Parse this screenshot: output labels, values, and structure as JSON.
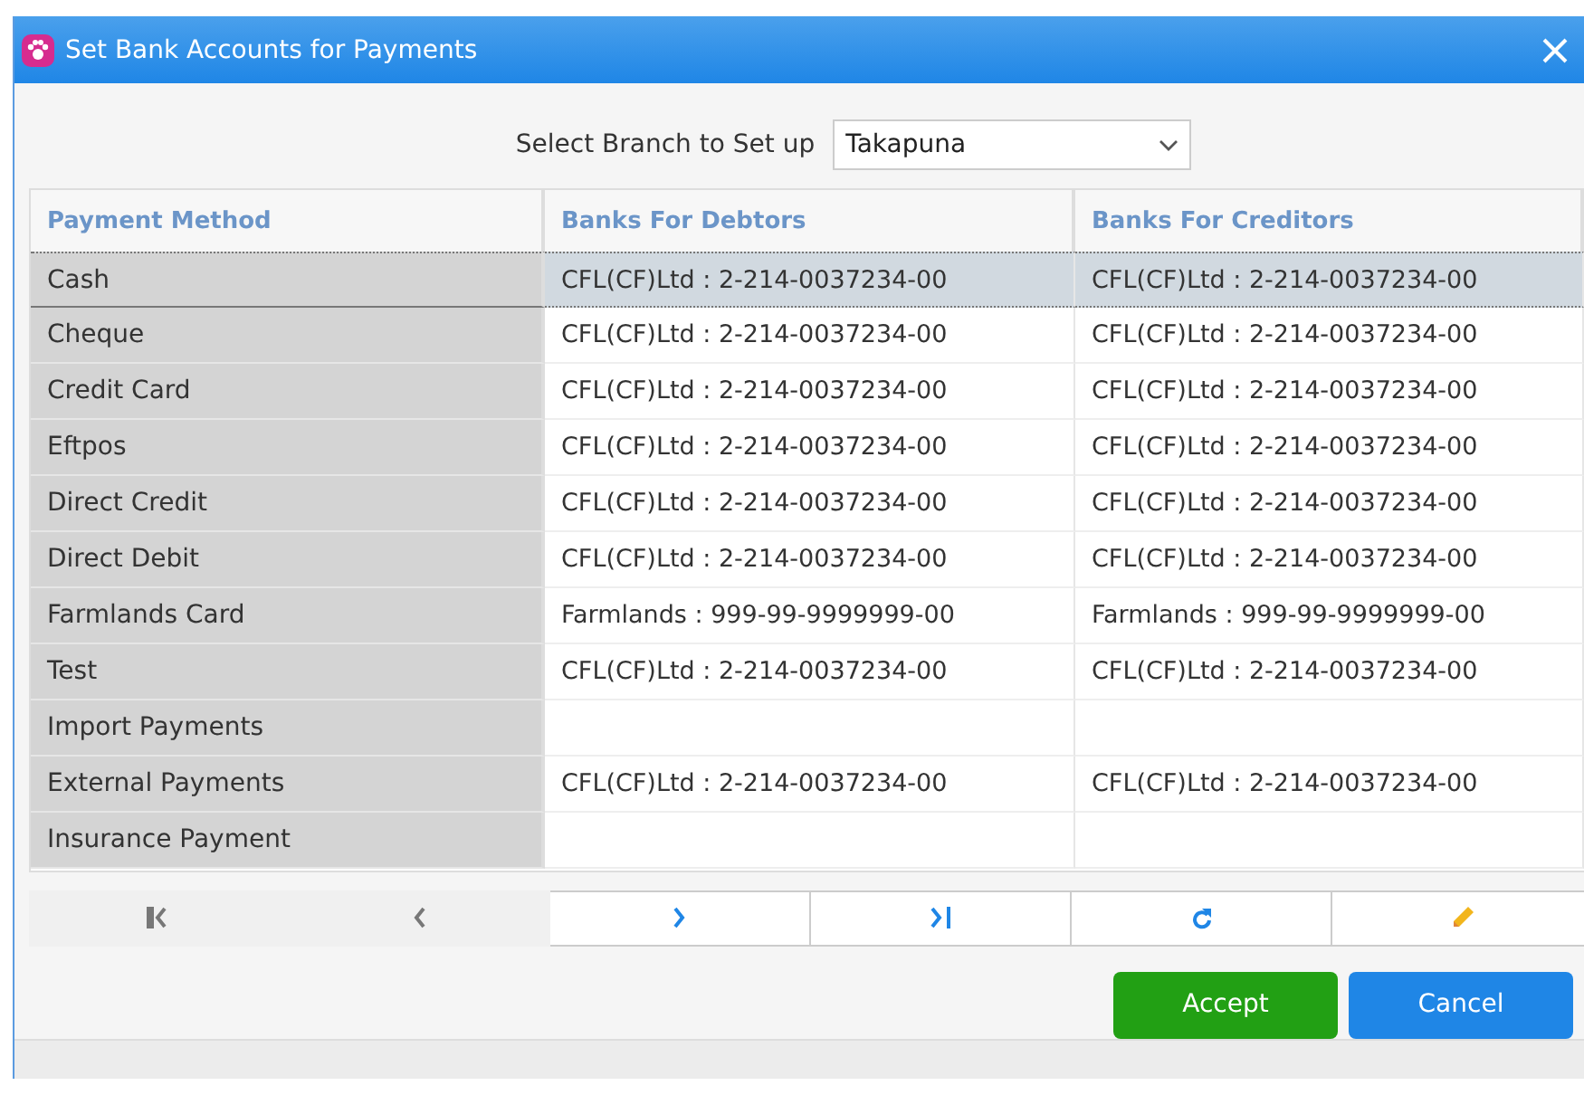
{
  "window": {
    "title": "Set Bank Accounts for Payments"
  },
  "branch": {
    "label": "Select Branch to Set up",
    "value": "Takapuna"
  },
  "table": {
    "columns": [
      "Payment Method",
      "Banks For Debtors",
      "Banks For Creditors"
    ],
    "rows": [
      {
        "method": "Cash",
        "debtors": "CFL(CF)Ltd : 2-214-0037234-00",
        "creditors": "CFL(CF)Ltd : 2-214-0037234-00",
        "selected": true
      },
      {
        "method": "Cheque",
        "debtors": "CFL(CF)Ltd : 2-214-0037234-00",
        "creditors": "CFL(CF)Ltd : 2-214-0037234-00",
        "selected": false
      },
      {
        "method": "Credit Card",
        "debtors": "CFL(CF)Ltd : 2-214-0037234-00",
        "creditors": "CFL(CF)Ltd : 2-214-0037234-00",
        "selected": false
      },
      {
        "method": "Eftpos",
        "debtors": "CFL(CF)Ltd : 2-214-0037234-00",
        "creditors": "CFL(CF)Ltd : 2-214-0037234-00",
        "selected": false
      },
      {
        "method": "Direct Credit",
        "debtors": "CFL(CF)Ltd : 2-214-0037234-00",
        "creditors": "CFL(CF)Ltd : 2-214-0037234-00",
        "selected": false
      },
      {
        "method": "Direct Debit",
        "debtors": "CFL(CF)Ltd : 2-214-0037234-00",
        "creditors": "CFL(CF)Ltd : 2-214-0037234-00",
        "selected": false
      },
      {
        "method": "Farmlands Card",
        "debtors": "Farmlands : 999-99-9999999-00",
        "creditors": "Farmlands : 999-99-9999999-00",
        "selected": false
      },
      {
        "method": "Test",
        "debtors": "CFL(CF)Ltd : 2-214-0037234-00",
        "creditors": "CFL(CF)Ltd : 2-214-0037234-00",
        "selected": false
      },
      {
        "method": "Import Payments",
        "selected": false
      },
      {
        "method": "External Payments",
        "debtors": "CFL(CF)Ltd : 2-214-0037234-00",
        "creditors": "CFL(CF)Ltd : 2-214-0037234-00",
        "selected": false
      },
      {
        "method": "Insurance Payment",
        "selected": false
      }
    ]
  },
  "navigator": [
    {
      "kind": "first",
      "disabled": true
    },
    {
      "kind": "prev",
      "disabled": true
    },
    {
      "kind": "next",
      "disabled": false
    },
    {
      "kind": "last",
      "disabled": false
    },
    {
      "kind": "refresh",
      "disabled": false
    },
    {
      "kind": "edit",
      "disabled": false
    }
  ],
  "buttons": [
    {
      "label": "Accept",
      "kind": "primary"
    },
    {
      "label": "Cancel",
      "kind": "secondary"
    }
  ]
}
